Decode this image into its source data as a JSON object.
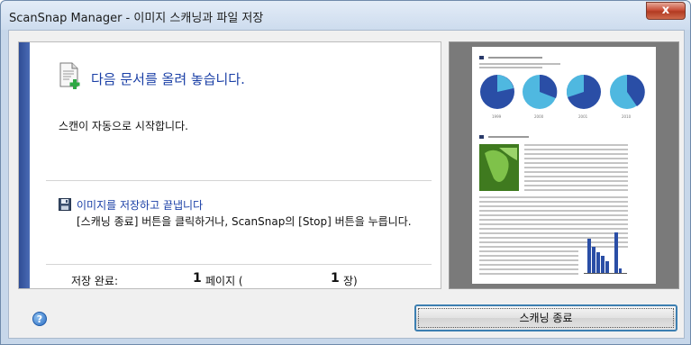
{
  "window": {
    "title": "ScanSnap Manager - 이미지 스캐닝과 파일 저장",
    "close_label": "x"
  },
  "info": {
    "heading": "다음 문서를 올려 놓습니다.",
    "auto_start": "스캔이 자동으로 시작합니다.",
    "save_title": "이미지를 저장하고 끝냅니다",
    "save_desc": "[스캐닝 종료] 버튼을 클릭하거나, ScanSnap의 [Stop] 버튼을 누릅니다."
  },
  "status": {
    "saved_label": "저장 완료:",
    "pages_count": "1",
    "pages_unit": "페이지 (",
    "sheets_count": "1",
    "sheets_unit": "장)"
  },
  "buttons": {
    "finish_label": "스캐닝 종료",
    "help_label": "?"
  },
  "preview": {
    "pie_years": [
      "1999",
      "2000",
      "2001",
      "2010"
    ]
  },
  "colors": {
    "accent": "#1a3fa6",
    "side_bar": "#2f4d95",
    "pie_dark": "#2a4ea6",
    "pie_light": "#4fb8e0"
  }
}
